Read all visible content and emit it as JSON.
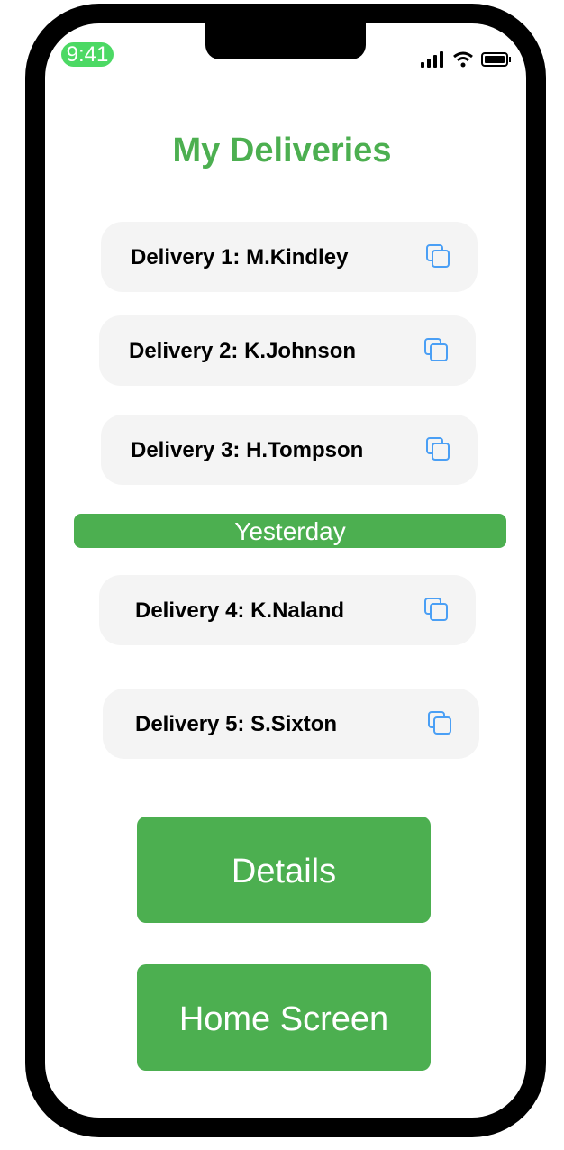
{
  "status_bar": {
    "time": "9:41"
  },
  "header": {
    "title": "My Deliveries"
  },
  "deliveries": [
    {
      "label": "Delivery 1: M.Kindley"
    },
    {
      "label": "Delivery 2: K.Johnson"
    },
    {
      "label": "Delivery 3: H.Tompson"
    },
    {
      "label": "Delivery 4: K.Naland"
    },
    {
      "label": "Delivery 5: S.Sixton"
    }
  ],
  "section": {
    "yesterday": "Yesterday"
  },
  "buttons": {
    "details": "Details",
    "home": "Home Screen"
  },
  "colors": {
    "accent": "#4caf50",
    "icon": "#4a9ff5"
  }
}
